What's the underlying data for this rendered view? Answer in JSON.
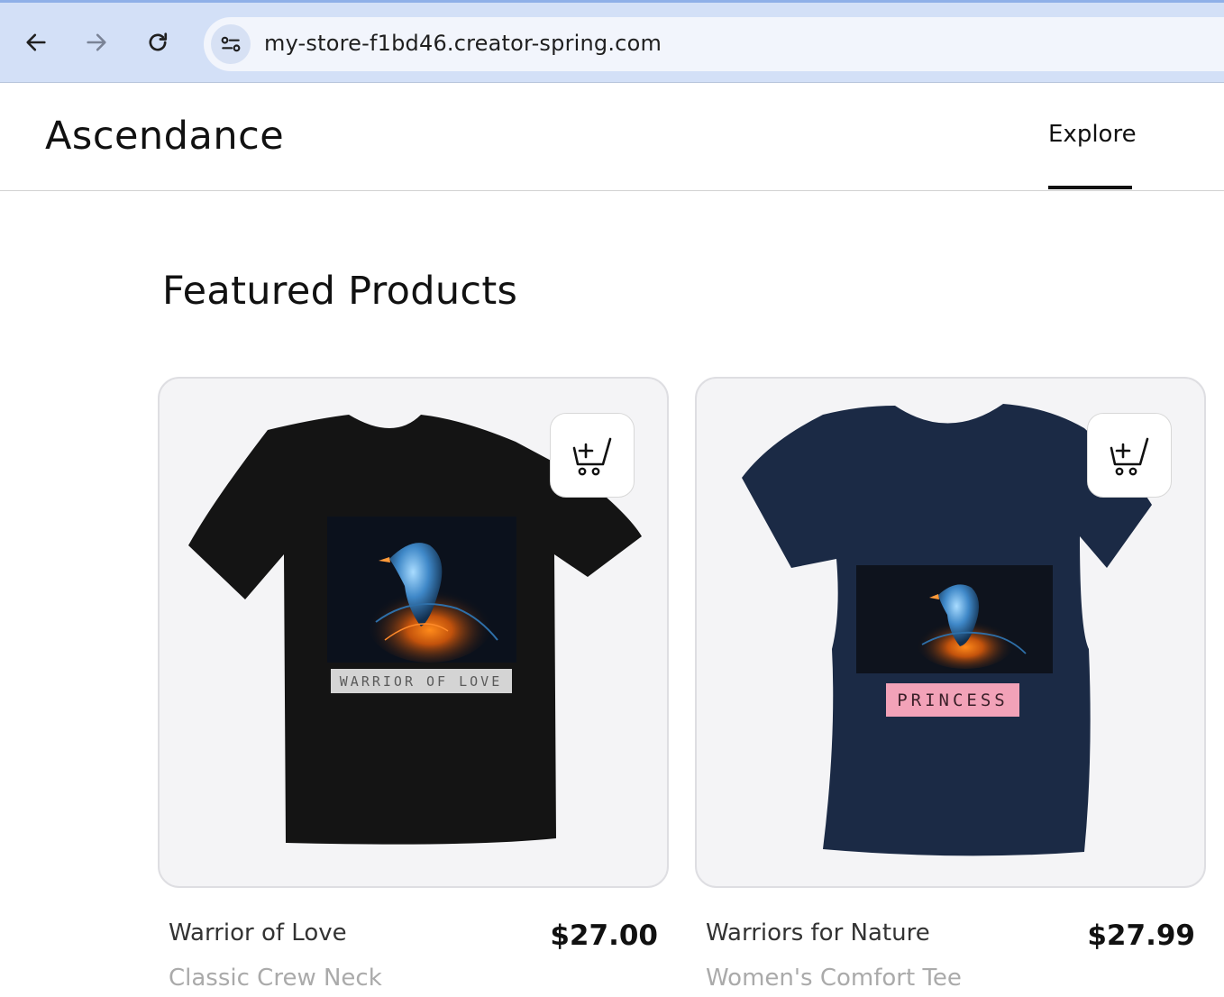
{
  "browser": {
    "url": "my-store-f1bd46.creator-spring.com"
  },
  "store": {
    "brand": "Ascendance",
    "nav": {
      "explore": "Explore"
    }
  },
  "section": {
    "title": "Featured Products"
  },
  "products": [
    {
      "name": "Warrior of Love",
      "price": "$27.00",
      "style": "Classic Crew Neck",
      "print_text": "WARRIOR OF LOVE",
      "shirt_color": "#141414",
      "label_bg": "#d4d4d4"
    },
    {
      "name": "Warriors for Nature",
      "price": "$27.99",
      "style": "Women's Comfort Tee",
      "print_text": "PRINCESS",
      "shirt_color": "#1b2a45",
      "label_bg": "#f2a2b8"
    }
  ]
}
